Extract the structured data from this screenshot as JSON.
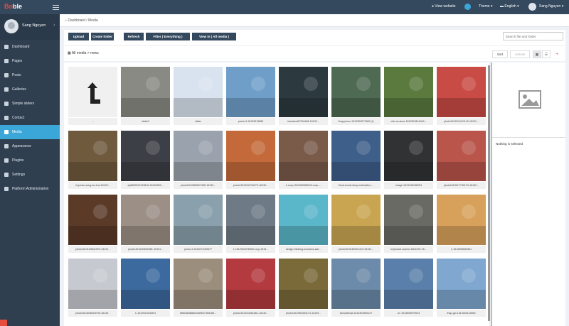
{
  "topbar": {
    "logo_red": "Bo",
    "logo_white": "ble",
    "view_website": "View website",
    "theme": "Theme ▾",
    "language": "English ▾",
    "user": "Sang Nguyen ▾"
  },
  "sidebar": {
    "user_name": "Sang Nguyen",
    "items": [
      {
        "name": "dashboard",
        "label": "Dashboard",
        "icon": "dashboard-icon"
      },
      {
        "name": "pages",
        "label": "Pages",
        "icon": "page-icon"
      },
      {
        "name": "posts",
        "label": "Posts",
        "icon": "post-icon"
      },
      {
        "name": "galleries",
        "label": "Galleries",
        "icon": "gallery-icon"
      },
      {
        "name": "simple-sliders",
        "label": "Simple sliders",
        "icon": "slider-icon"
      },
      {
        "name": "contact",
        "label": "Contact",
        "icon": "contact-icon"
      },
      {
        "name": "media",
        "label": "Media",
        "icon": "media-icon"
      },
      {
        "name": "appearance",
        "label": "Appearance",
        "icon": "brush-icon"
      },
      {
        "name": "plugins",
        "label": "Plugins",
        "icon": "plug-icon"
      },
      {
        "name": "settings",
        "label": "Settings",
        "icon": "gear-icon"
      },
      {
        "name": "platform-administration",
        "label": "Platform Administration",
        "icon": "user-icon"
      }
    ],
    "active": "media"
  },
  "breadcrumb": {
    "text": "Dashboard / Media"
  },
  "toolbar": {
    "upload": "Upload",
    "create_folder": "Create folder",
    "refresh": "Refresh",
    "filter": "Filter ( Everything )",
    "view_in": "View in ( All media )",
    "search_placeholder": "Search file and folder"
  },
  "pathbar": {
    "path": "All media  >  news",
    "sort": "Sort",
    "actions": "Actions"
  },
  "media_items": [
    {
      "caption": "...",
      "color": "#f0f0f0",
      "folder": true
    },
    {
      "caption": "slider2",
      "color": "#8a8a84"
    },
    {
      "caption": "slider",
      "color": "#d9e3ef"
    },
    {
      "caption": "photo-3-15133313986",
      "color": "#6f9fc9"
    },
    {
      "caption": "livestand1700x348-15133...",
      "color": "#2c3a3f"
    },
    {
      "caption": "2copy1nov-1513303077662 (1)",
      "color": "#4e6a52"
    },
    {
      "caption": "che-va-shoe-1513303414049...",
      "color": "#5a7a3e"
    },
    {
      "caption": "photo1513314121142-15131...",
      "color": "#c94b45"
    },
    {
      "caption": "hop-bao-song-bo-tuoi-15132...",
      "color": "#6f5a3e"
    },
    {
      "caption": "ap5659491123816-15132953...",
      "color": "#3c3f45"
    },
    {
      "caption": "photo1513260527465-15132...",
      "color": "#9aa3ad"
    },
    {
      "caption": "photo1513242715273-15132...",
      "color": "#c46a3a"
    },
    {
      "caption": "1-crop-1513260980913-crop-...",
      "color": "#7a5b4a"
    },
    {
      "caption": "flood-mural-story-motivation-...",
      "color": "#3e5f8a"
    },
    {
      "caption": "image-1513135196294",
      "color": "#303234"
    },
    {
      "caption": "photo1513217730173-15132...",
      "color": "#b9554a"
    },
    {
      "caption": "photo1513149641929-15131...",
      "color": "#5b3a28"
    },
    {
      "caption": "photo1513203630981-15131...",
      "color": "#9b8f86"
    },
    {
      "caption": "photo-4-1513071199577",
      "color": "#8aa0ac"
    },
    {
      "caption": "1-1512934376609-crop-1513...",
      "color": "#6e7a85"
    },
    {
      "caption": "design-thinking-business-sait...",
      "color": "#5ab6c9"
    },
    {
      "caption": "photo1513162921413-15131...",
      "color": "#c9a552"
    },
    {
      "caption": "keyboard-warrior-600x370-15...",
      "color": "#6a6a64"
    },
    {
      "caption": "1-1513305652561",
      "color": "#d7a15b"
    },
    {
      "caption": "photo1513036925795-15130...",
      "color": "#c6c9cf"
    },
    {
      "caption": "1-1512941516991",
      "color": "#3c6a9e"
    },
    {
      "caption": "58be663888e2bd9b074b5185...",
      "color": "#9c8e7c"
    },
    {
      "caption": "photo1513234481561-15132...",
      "color": "#b33a3f"
    },
    {
      "caption": "photo1512953454174-15129...",
      "color": "#7a6a3a"
    },
    {
      "caption": "simulatenaf-1513304950127",
      "color": "#6c8aa9"
    },
    {
      "caption": "a7-1513509679024",
      "color": "#5a7faa"
    },
    {
      "caption": "thap-gio-1513000113550",
      "color": "#7fa7cf"
    }
  ],
  "detail": {
    "nothing": "Nothing is selected"
  }
}
